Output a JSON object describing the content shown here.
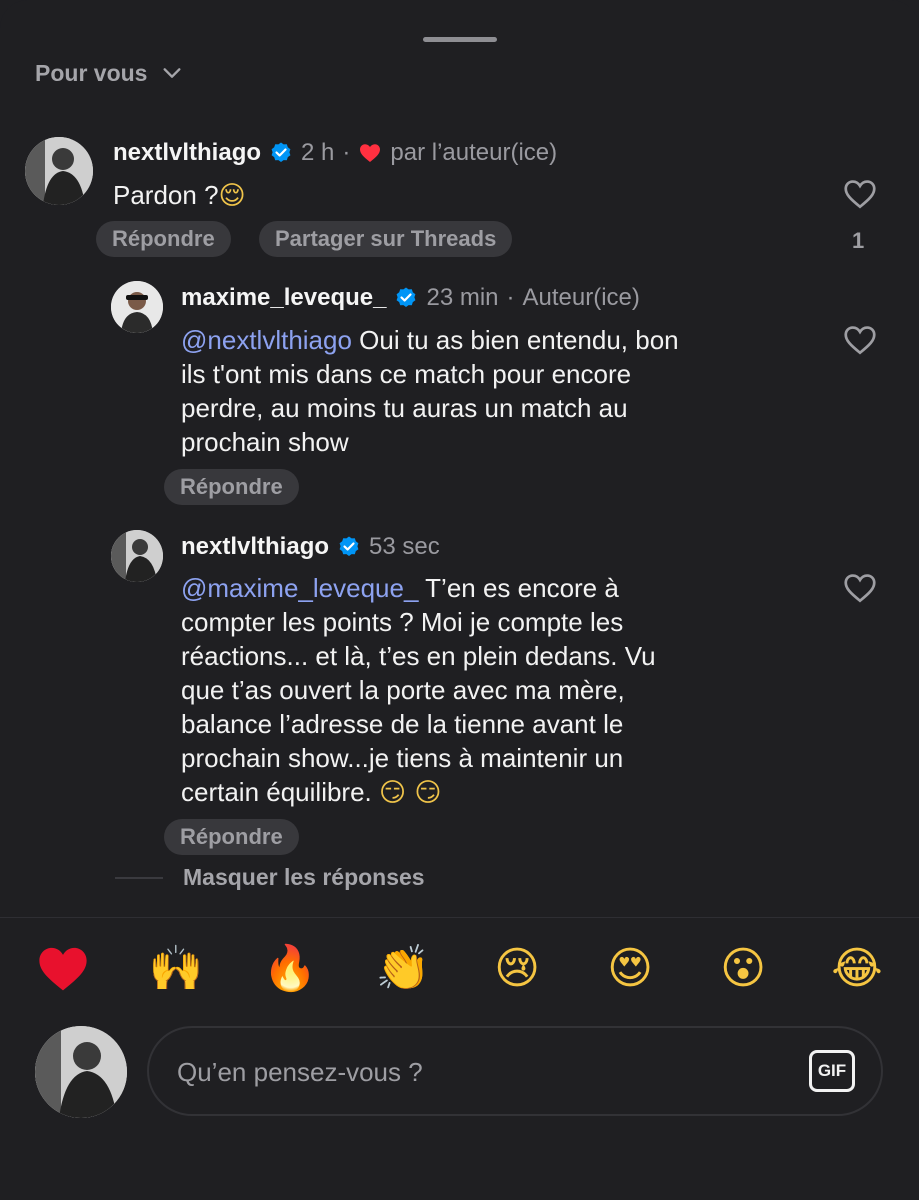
{
  "header": {
    "feed_label": "Pour vous",
    "dropdown_icon": "chevron-down-icon"
  },
  "comments": [
    {
      "username": "nextlvlthiago",
      "time": "2 h",
      "separator": "·",
      "liked_by_author_label": "par l’auteur(ice)",
      "text": "Pardon ?",
      "emoji": "😌",
      "reply_label": "Répondre",
      "share_label": "Partager sur Threads",
      "like_count": "1"
    },
    {
      "username": "maxime_leveque_",
      "time": "23 min",
      "separator": "·",
      "author_tag": "Auteur(ice)",
      "mention": "@nextlvlthiago",
      "lines": [
        " Oui tu as bien entendu, bon",
        "ils t'ont mis dans ce match pour encore",
        "perdre, au moins tu auras un match au",
        "prochain show"
      ],
      "reply_label": "Répondre"
    },
    {
      "username": "nextlvlthiago",
      "time": "53 sec",
      "mention": "@maxime_leveque_",
      "lines": [
        " T’en es encore à",
        "compter les points ? Moi je compte les",
        "réactions... et là, t’es en plein dedans. Vu",
        "que t’as ouvert la porte avec ma mère,",
        "balance l’adresse de la tienne avant le",
        "prochain show...je tiens à maintenir un",
        "certain équilibre. "
      ],
      "emoji": "😏 😏",
      "reply_label": "Répondre"
    }
  ],
  "hide_replies_label": "Masquer les réponses",
  "reactions": [
    "❤️",
    "🙌",
    "🔥",
    "👏",
    "😢",
    "😍",
    "😮",
    "😂"
  ],
  "composer": {
    "placeholder": "Qu’en pensez-vous ?",
    "gif_label": "GIF"
  },
  "colors": {
    "background": "#1f1f22",
    "pill": "#38383c",
    "mention": "#8da2f0",
    "verified": "#0095f6",
    "heart": "#ff3040"
  }
}
